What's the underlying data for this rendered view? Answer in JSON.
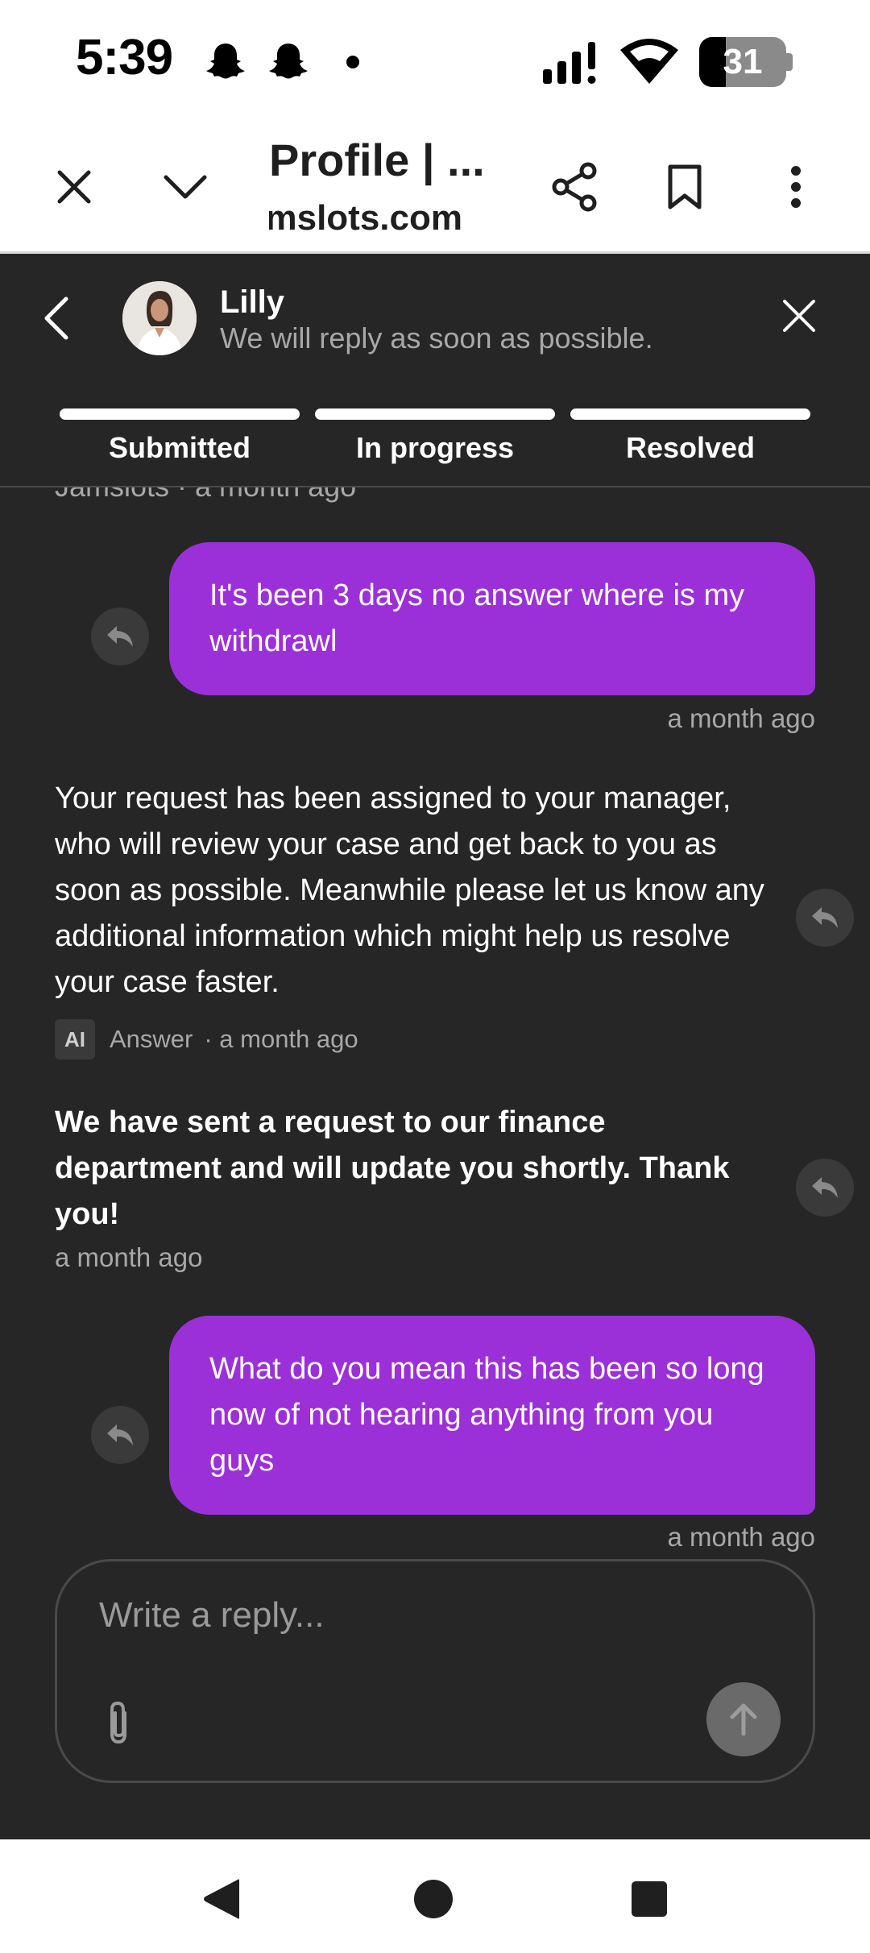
{
  "status_bar": {
    "time": "5:39",
    "battery": "31",
    "battery_fraction": 0.31,
    "icons": [
      "snapchat-ghost-icon",
      "snapchat-ghost-icon",
      "notification-dot-icon",
      "signal-icon",
      "wifi-icon",
      "battery-icon"
    ]
  },
  "browser": {
    "title": "Profile | ...",
    "url": "Jamslots.com",
    "icons": [
      "close-icon",
      "chevron-down-icon",
      "share-icon",
      "bookmark-icon",
      "more-vert-icon"
    ]
  },
  "chat": {
    "agent_name": "Lilly",
    "agent_status": "We will reply as soon as possible.",
    "steps": [
      "Submitted",
      "In progress",
      "Resolved"
    ],
    "partial_meta": "Jamslots · a month ago",
    "messages": [
      {
        "from": "user",
        "text": "It's been 3 days no answer where is my withdrawl",
        "time": "a month ago"
      },
      {
        "from": "agent",
        "text": "Your request has been assigned to your manager, who will review your case and get back to you as soon as possible. Meanwhile please let us know any additional information which might help us resolve your case faster.",
        "badge": "AI",
        "sender": "Answer",
        "time": "· a month ago"
      },
      {
        "from": "agent",
        "text": "We have sent a request to our finance department and will update you shortly. Thank you!",
        "time": "a month ago"
      },
      {
        "from": "user",
        "text": "What do you mean this has been so long now of not hearing anything from you guys",
        "time": "a month ago"
      }
    ],
    "composer_placeholder": "Write a reply...",
    "colors": {
      "background": "#262626",
      "user_bubble": "#9b30d9",
      "muted_text": "#a8a8a8"
    }
  },
  "navbar": {
    "icons": [
      "back-triangle-icon",
      "home-circle-icon",
      "recents-square-icon"
    ]
  }
}
